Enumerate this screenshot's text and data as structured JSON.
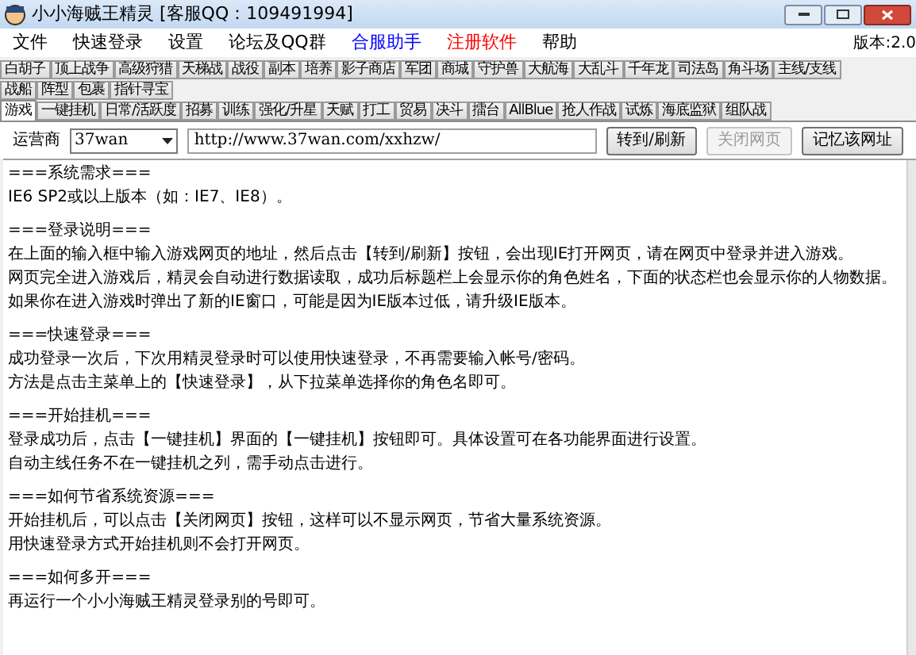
{
  "window": {
    "title": "小小海贼王精灵 [客服QQ：109491994]"
  },
  "menu": {
    "items": [
      {
        "label": "文件",
        "color": "#000000"
      },
      {
        "label": "快速登录",
        "color": "#000000"
      },
      {
        "label": "设置",
        "color": "#000000"
      },
      {
        "label": "论坛及QQ群",
        "color": "#000000"
      },
      {
        "label": "合服助手",
        "color": "#0000ff"
      },
      {
        "label": "注册软件",
        "color": "#ff0000"
      },
      {
        "label": "帮助",
        "color": "#000000"
      }
    ],
    "version": "版本:2.0"
  },
  "tab_rows": [
    [
      {
        "label": "白胡子",
        "selected": false
      },
      {
        "label": "顶上战争",
        "selected": false
      },
      {
        "label": "高级狩猎",
        "selected": false
      },
      {
        "label": "天梯战",
        "selected": false
      },
      {
        "label": "战役",
        "selected": false
      },
      {
        "label": "副本",
        "selected": false
      },
      {
        "label": "培养",
        "selected": false
      },
      {
        "label": "影子商店",
        "selected": false
      },
      {
        "label": "军团",
        "selected": false
      },
      {
        "label": "商城",
        "selected": false
      },
      {
        "label": "守护兽",
        "selected": false
      },
      {
        "label": "大航海",
        "selected": false
      },
      {
        "label": "大乱斗",
        "selected": false
      },
      {
        "label": "千年龙",
        "selected": false
      },
      {
        "label": "司法岛",
        "selected": false
      },
      {
        "label": "角斗场",
        "selected": false
      },
      {
        "label": "主线/支线",
        "selected": false
      }
    ],
    [
      {
        "label": "战船",
        "selected": false
      },
      {
        "label": "阵型",
        "selected": false
      },
      {
        "label": "包裹",
        "selected": false
      },
      {
        "label": "指针寻宝",
        "selected": false
      }
    ],
    [
      {
        "label": "游戏",
        "selected": true
      },
      {
        "label": "一键挂机",
        "selected": false
      },
      {
        "label": "日常/活跃度",
        "selected": false
      },
      {
        "label": "招募",
        "selected": false
      },
      {
        "label": "训练",
        "selected": false
      },
      {
        "label": "强化/升星",
        "selected": false
      },
      {
        "label": "天赋",
        "selected": false
      },
      {
        "label": "打工",
        "selected": false
      },
      {
        "label": "贸易",
        "selected": false
      },
      {
        "label": "决斗",
        "selected": false
      },
      {
        "label": "擂台",
        "selected": false
      },
      {
        "label": "AllBlue",
        "selected": false
      },
      {
        "label": "抢人作战",
        "selected": false
      },
      {
        "label": "试炼",
        "selected": false
      },
      {
        "label": "海底监狱",
        "selected": false
      },
      {
        "label": "组队战",
        "selected": false
      }
    ]
  ],
  "toolbar": {
    "operator_label": "运营商",
    "operator": "37wan",
    "url": "http://www.37wan.com/xxhzw/",
    "buttons": [
      {
        "label": "转到/刷新",
        "disabled": false
      },
      {
        "label": "关闭网页",
        "disabled": true
      },
      {
        "label": "记忆该网址",
        "disabled": false
      }
    ]
  },
  "content": [
    {
      "heading": "===系统需求===",
      "lines": [
        "IE6 SP2或以上版本（如：IE7、IE8）。"
      ]
    },
    {
      "heading": "===登录说明===",
      "lines": [
        "在上面的输入框中输入游戏网页的地址，然后点击【转到/刷新】按钮，会出现IE打开网页，请在网页中登录并进入游戏。",
        "网页完全进入游戏后，精灵会自动进行数据读取，成功后标题栏上会显示你的角色姓名，下面的状态栏也会显示你的人物数据。",
        "如果你在进入游戏时弹出了新的IE窗口，可能是因为IE版本过低，请升级IE版本。"
      ]
    },
    {
      "heading": "===快速登录===",
      "lines": [
        "成功登录一次后，下次用精灵登录时可以使用快速登录，不再需要输入帐号/密码。",
        "方法是点击主菜单上的【快速登录】，从下拉菜单选择你的角色名即可。"
      ]
    },
    {
      "heading": "===开始挂机===",
      "lines": [
        "登录成功后，点击【一键挂机】界面的【一键挂机】按钮即可。具体设置可在各功能界面进行设置。",
        "自动主线任务不在一键挂机之列，需手动点击进行。"
      ]
    },
    {
      "heading": "===如何节省系统资源===",
      "lines": [
        "开始挂机后，可以点击【关闭网页】按钮，这样可以不显示网页，节省大量系统资源。",
        "用快速登录方式开始挂机则不会打开网页。"
      ]
    },
    {
      "heading": "===如何多开===",
      "lines": [
        "再运行一个小小海贼王精灵登录别的号即可。"
      ]
    }
  ]
}
